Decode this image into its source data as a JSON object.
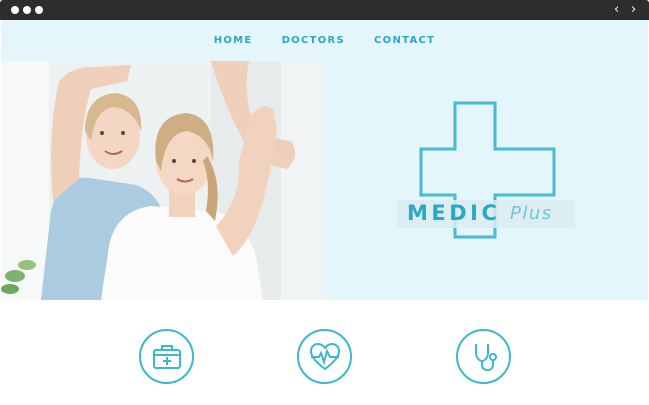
{
  "window": {
    "controls": [
      "window-dot",
      "window-dot",
      "window-dot"
    ],
    "back_glyph": "‹",
    "forward_glyph": "›"
  },
  "nav": {
    "items": [
      {
        "label": "HOME"
      },
      {
        "label": "DOCTORS"
      },
      {
        "label": "CONTACT"
      }
    ]
  },
  "hero": {
    "image": "physiotherapist-stretching-patient-arm-photo",
    "logo": {
      "word_bold": "MEDIC",
      "word_light": "Plus",
      "icon": "cross-outline-icon"
    }
  },
  "features": [
    {
      "icon": "first-aid-kit-icon"
    },
    {
      "icon": "heart-pulse-icon"
    },
    {
      "icon": "stethoscope-icon"
    }
  ],
  "colors": {
    "accent": "#2aa9c2",
    "accent_light": "#6fc7d8",
    "hero_background": "#e4f5fb",
    "titlebar": "#2d2d2d"
  }
}
